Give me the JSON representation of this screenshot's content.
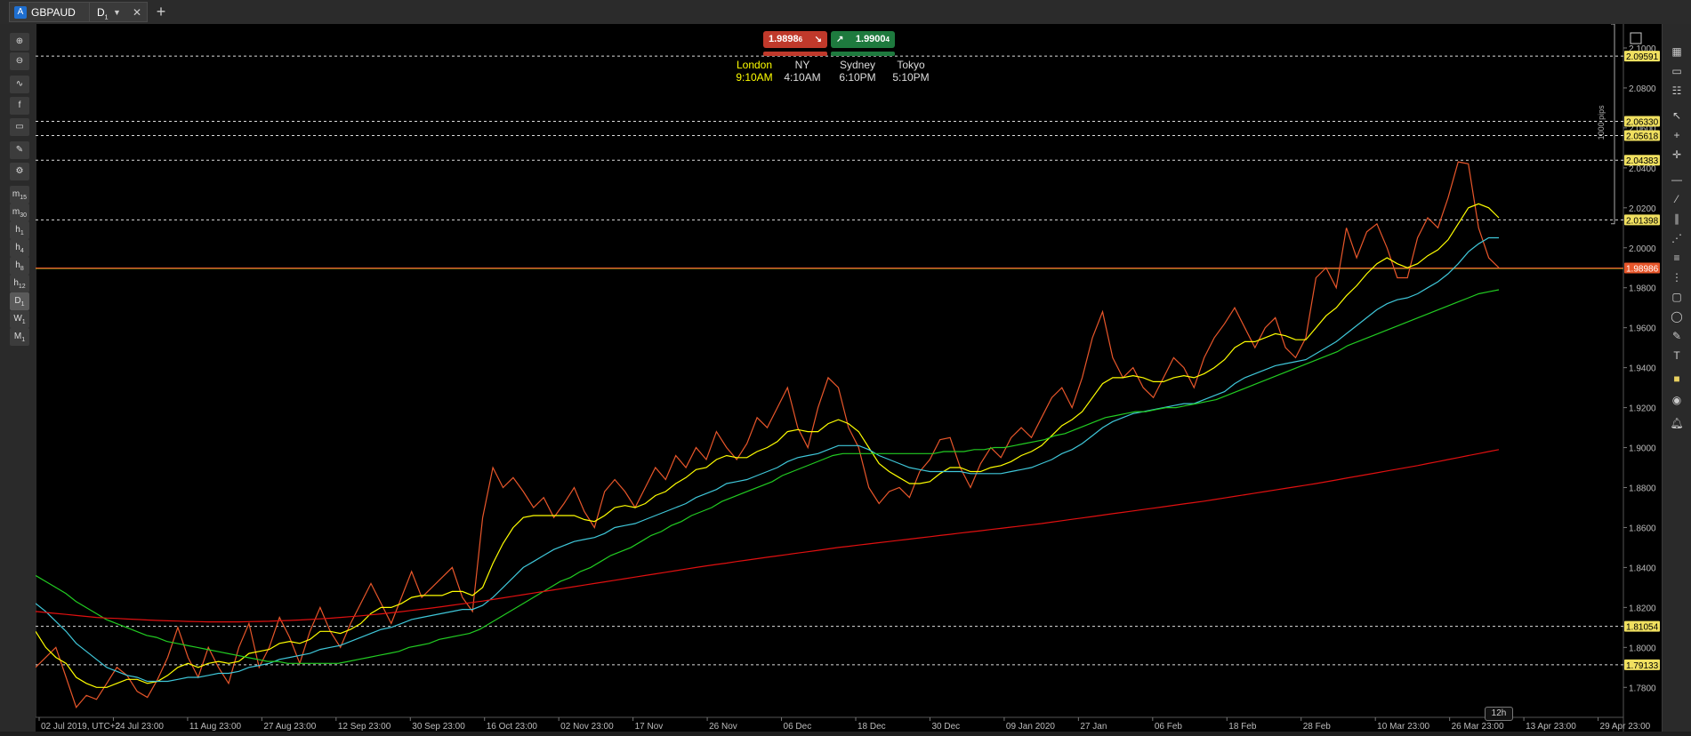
{
  "tabs": {
    "symbol": "GBPAUD",
    "symbol_icon_letter": "A",
    "timeframe": "D",
    "timeframe_sub": "1"
  },
  "left_toolbar": [
    {
      "label": "",
      "icon": "zoom-in-icon"
    },
    {
      "label": "",
      "icon": "zoom-out-icon"
    },
    {
      "label": "",
      "icon": "indicator-icon"
    },
    {
      "label": "",
      "icon": "facebook-icon"
    },
    {
      "label": "",
      "icon": "chart-type-icon"
    },
    {
      "label": "",
      "icon": "paint-icon"
    },
    {
      "label": "",
      "icon": "settings-icon"
    },
    {
      "label": "m",
      "sub": "15"
    },
    {
      "label": "m",
      "sub": "30"
    },
    {
      "label": "h",
      "sub": "1"
    },
    {
      "label": "h",
      "sub": "4"
    },
    {
      "label": "h",
      "sub": "8"
    },
    {
      "label": "h",
      "sub": "12"
    },
    {
      "label": "D",
      "sub": "1"
    },
    {
      "label": "W",
      "sub": "1"
    },
    {
      "label": "M",
      "sub": "1"
    }
  ],
  "prices": {
    "sell": "1.9898",
    "sell_suffix": "6",
    "buy": "1.9900",
    "buy_suffix": "4"
  },
  "sessions": [
    {
      "city": "London",
      "time": "9:10AM",
      "color": "#ffff00"
    },
    {
      "city": "NY",
      "time": "4:10AM",
      "color": "#ffffff"
    },
    {
      "city": "Sydney",
      "time": "6:10PM",
      "color": "#ffffff"
    },
    {
      "city": "Tokyo",
      "time": "5:10PM",
      "color": "#ffffff"
    }
  ],
  "pips_label": "1000 pips",
  "badge": "12h",
  "chart_data": {
    "type": "line",
    "ylim": [
      1.765,
      2.112
    ],
    "y_ticks": [
      "2.1000",
      "2.0800",
      "2.0600",
      "2.0400",
      "2.0200",
      "2.0000",
      "1.9800",
      "1.9600",
      "1.9400",
      "1.9200",
      "1.9000",
      "1.8800",
      "1.8600",
      "1.8400",
      "1.8200",
      "1.8000",
      "1.7800"
    ],
    "x_ticks": [
      "02 Jul 2019, UTC+2",
      "24 Jul 23:00",
      "11 Aug 23:00",
      "27 Aug 23:00",
      "12 Sep 23:00",
      "30 Sep 23:00",
      "16 Oct 23:00",
      "02 Nov 23:00",
      "17 Nov",
      "26 Nov",
      "06 Dec",
      "18 Dec",
      "30 Dec",
      "09 Jan 2020",
      "27 Jan",
      "06 Feb",
      "18 Feb",
      "28 Feb",
      "10 Mar 23:00",
      "26 Mar 23:00",
      "13 Apr 23:00",
      "29 Apr 23:00"
    ],
    "level_lines": [
      {
        "value": 2.09591,
        "label": "2.09591"
      },
      {
        "value": 2.0633,
        "label": "2.06330"
      },
      {
        "value": 2.05618,
        "label": "2.05618"
      },
      {
        "value": 2.04383,
        "label": "2.04383"
      },
      {
        "value": 2.01398,
        "label": "2.01398"
      },
      {
        "value": 1.81054,
        "label": "1.81054"
      },
      {
        "value": 1.79133,
        "label": "1.79133"
      }
    ],
    "current_price": {
      "value": 1.98986,
      "label": "1.98986"
    },
    "series": [
      {
        "color": "#e8562a",
        "values": [
          1.79,
          1.795,
          1.8,
          1.785,
          1.77,
          1.776,
          1.774,
          1.782,
          1.79,
          1.786,
          1.778,
          1.775,
          1.784,
          1.795,
          1.81,
          1.795,
          1.785,
          1.8,
          1.79,
          1.782,
          1.8,
          1.812,
          1.79,
          1.8,
          1.815,
          1.805,
          1.792,
          1.808,
          1.82,
          1.808,
          1.8,
          1.812,
          1.822,
          1.832,
          1.822,
          1.812,
          1.825,
          1.838,
          1.825,
          1.83,
          1.835,
          1.84,
          1.825,
          1.818,
          1.865,
          1.89,
          1.88,
          1.885,
          1.878,
          1.87,
          1.875,
          1.865,
          1.872,
          1.88,
          1.868,
          1.86,
          1.878,
          1.884,
          1.878,
          1.87,
          1.88,
          1.89,
          1.884,
          1.896,
          1.89,
          1.9,
          1.894,
          1.908,
          1.9,
          1.894,
          1.902,
          1.915,
          1.91,
          1.92,
          1.93,
          1.91,
          1.9,
          1.92,
          1.935,
          1.93,
          1.91,
          1.9,
          1.88,
          1.872,
          1.878,
          1.88,
          1.875,
          1.888,
          1.894,
          1.904,
          1.905,
          1.89,
          1.88,
          1.892,
          1.9,
          1.895,
          1.905,
          1.91,
          1.905,
          1.915,
          1.925,
          1.93,
          1.92,
          1.935,
          1.955,
          1.968,
          1.945,
          1.935,
          1.94,
          1.93,
          1.925,
          1.935,
          1.945,
          1.94,
          1.93,
          1.945,
          1.955,
          1.962,
          1.97,
          1.96,
          1.95,
          1.96,
          1.965,
          1.95,
          1.945,
          1.955,
          1.985,
          1.99,
          1.98,
          2.01,
          1.995,
          2.008,
          2.012,
          2.0,
          1.985,
          1.985,
          2.005,
          2.015,
          2.01,
          2.025,
          2.043,
          2.042,
          2.01,
          1.995,
          1.99
        ]
      },
      {
        "color": "#ffff00",
        "values": [
          1.808,
          1.8,
          1.795,
          1.792,
          1.785,
          1.782,
          1.78,
          1.78,
          1.782,
          1.784,
          1.784,
          1.782,
          1.783,
          1.786,
          1.79,
          1.792,
          1.79,
          1.792,
          1.793,
          1.792,
          1.793,
          1.797,
          1.798,
          1.799,
          1.802,
          1.803,
          1.802,
          1.804,
          1.808,
          1.808,
          1.807,
          1.809,
          1.812,
          1.817,
          1.82,
          1.82,
          1.822,
          1.825,
          1.826,
          1.826,
          1.826,
          1.828,
          1.828,
          1.826,
          1.83,
          1.842,
          1.852,
          1.86,
          1.865,
          1.866,
          1.866,
          1.866,
          1.866,
          1.866,
          1.864,
          1.863,
          1.866,
          1.87,
          1.871,
          1.87,
          1.872,
          1.876,
          1.878,
          1.882,
          1.885,
          1.889,
          1.89,
          1.894,
          1.896,
          1.895,
          1.895,
          1.898,
          1.9,
          1.903,
          1.908,
          1.909,
          1.908,
          1.908,
          1.912,
          1.914,
          1.912,
          1.908,
          1.9,
          1.892,
          1.888,
          1.885,
          1.882,
          1.882,
          1.883,
          1.887,
          1.89,
          1.89,
          1.888,
          1.888,
          1.89,
          1.891,
          1.893,
          1.896,
          1.898,
          1.901,
          1.906,
          1.911,
          1.914,
          1.918,
          1.925,
          1.932,
          1.935,
          1.935,
          1.936,
          1.935,
          1.933,
          1.933,
          1.935,
          1.936,
          1.935,
          1.937,
          1.94,
          1.944,
          1.95,
          1.953,
          1.953,
          1.955,
          1.957,
          1.956,
          1.954,
          1.954,
          1.96,
          1.966,
          1.97,
          1.976,
          1.981,
          1.987,
          1.992,
          1.995,
          1.992,
          1.99,
          1.992,
          1.996,
          1.999,
          2.004,
          2.012,
          2.02,
          2.022,
          2.02,
          2.015
        ]
      },
      {
        "color": "#3fc7d9",
        "values": [
          1.822,
          1.818,
          1.813,
          1.808,
          1.802,
          1.798,
          1.794,
          1.79,
          1.788,
          1.786,
          1.785,
          1.783,
          1.783,
          1.783,
          1.784,
          1.785,
          1.785,
          1.786,
          1.787,
          1.787,
          1.788,
          1.79,
          1.791,
          1.792,
          1.794,
          1.795,
          1.796,
          1.797,
          1.799,
          1.8,
          1.801,
          1.803,
          1.805,
          1.807,
          1.809,
          1.81,
          1.812,
          1.814,
          1.815,
          1.816,
          1.817,
          1.818,
          1.819,
          1.819,
          1.821,
          1.825,
          1.83,
          1.835,
          1.84,
          1.843,
          1.846,
          1.849,
          1.851,
          1.853,
          1.854,
          1.855,
          1.857,
          1.86,
          1.861,
          1.862,
          1.864,
          1.866,
          1.868,
          1.87,
          1.872,
          1.875,
          1.877,
          1.879,
          1.882,
          1.883,
          1.884,
          1.886,
          1.888,
          1.89,
          1.893,
          1.895,
          1.896,
          1.897,
          1.899,
          1.901,
          1.901,
          1.901,
          1.899,
          1.896,
          1.894,
          1.892,
          1.89,
          1.889,
          1.888,
          1.888,
          1.888,
          1.888,
          1.887,
          1.887,
          1.887,
          1.887,
          1.888,
          1.889,
          1.89,
          1.892,
          1.894,
          1.897,
          1.899,
          1.902,
          1.906,
          1.91,
          1.913,
          1.915,
          1.917,
          1.918,
          1.919,
          1.92,
          1.921,
          1.922,
          1.922,
          1.924,
          1.926,
          1.928,
          1.932,
          1.935,
          1.937,
          1.939,
          1.941,
          1.942,
          1.943,
          1.944,
          1.947,
          1.95,
          1.953,
          1.957,
          1.961,
          1.965,
          1.969,
          1.972,
          1.974,
          1.975,
          1.977,
          1.98,
          1.983,
          1.987,
          1.992,
          1.998,
          2.002,
          2.005,
          2.005
        ]
      },
      {
        "color": "#22cc22",
        "values": [
          1.836,
          1.833,
          1.83,
          1.827,
          1.823,
          1.82,
          1.817,
          1.814,
          1.812,
          1.81,
          1.808,
          1.806,
          1.805,
          1.803,
          1.802,
          1.801,
          1.8,
          1.799,
          1.798,
          1.797,
          1.796,
          1.795,
          1.794,
          1.793,
          1.793,
          1.792,
          1.792,
          1.792,
          1.792,
          1.792,
          1.792,
          1.793,
          1.794,
          1.795,
          1.796,
          1.797,
          1.798,
          1.8,
          1.801,
          1.802,
          1.804,
          1.805,
          1.806,
          1.807,
          1.809,
          1.812,
          1.815,
          1.818,
          1.821,
          1.824,
          1.827,
          1.83,
          1.833,
          1.835,
          1.838,
          1.84,
          1.843,
          1.846,
          1.848,
          1.85,
          1.853,
          1.856,
          1.858,
          1.861,
          1.863,
          1.866,
          1.868,
          1.87,
          1.873,
          1.875,
          1.877,
          1.879,
          1.881,
          1.883,
          1.886,
          1.888,
          1.89,
          1.892,
          1.894,
          1.896,
          1.897,
          1.897,
          1.897,
          1.897,
          1.897,
          1.897,
          1.897,
          1.897,
          1.897,
          1.897,
          1.898,
          1.898,
          1.898,
          1.899,
          1.899,
          1.9,
          1.9,
          1.901,
          1.902,
          1.903,
          1.904,
          1.906,
          1.907,
          1.909,
          1.911,
          1.913,
          1.915,
          1.916,
          1.917,
          1.918,
          1.918,
          1.919,
          1.92,
          1.92,
          1.921,
          1.922,
          1.923,
          1.924,
          1.926,
          1.928,
          1.93,
          1.932,
          1.934,
          1.936,
          1.938,
          1.94,
          1.942,
          1.944,
          1.946,
          1.948,
          1.951,
          1.953,
          1.955,
          1.957,
          1.959,
          1.961,
          1.963,
          1.965,
          1.967,
          1.969,
          1.971,
          1.973,
          1.975,
          1.977,
          1.978,
          1.979
        ]
      },
      {
        "color": "#e01010",
        "values": [
          1.818,
          1.8175,
          1.817,
          1.8165,
          1.816,
          1.8155,
          1.815,
          1.8147,
          1.8145,
          1.8142,
          1.814,
          1.8137,
          1.8135,
          1.8133,
          1.8132,
          1.813,
          1.8129,
          1.8128,
          1.8128,
          1.8128,
          1.8128,
          1.8129,
          1.813,
          1.8131,
          1.8133,
          1.8135,
          1.8137,
          1.814,
          1.8143,
          1.8146,
          1.815,
          1.8154,
          1.8158,
          1.8163,
          1.8168,
          1.8173,
          1.8179,
          1.8185,
          1.8191,
          1.8197,
          1.8204,
          1.8211,
          1.8218,
          1.8225,
          1.8232,
          1.824,
          1.8248,
          1.8256,
          1.8264,
          1.8272,
          1.828,
          1.8288,
          1.8296,
          1.8304,
          1.8312,
          1.832,
          1.8328,
          1.8336,
          1.8344,
          1.8352,
          1.836,
          1.8368,
          1.8376,
          1.8384,
          1.8392,
          1.84,
          1.8408,
          1.8415,
          1.8422,
          1.843,
          1.8437,
          1.8444,
          1.8451,
          1.8458,
          1.8465,
          1.8472,
          1.8479,
          1.8486,
          1.8493,
          1.85,
          1.8506,
          1.8512,
          1.8518,
          1.8524,
          1.853,
          1.8536,
          1.8542,
          1.8548,
          1.8554,
          1.856,
          1.8566,
          1.8572,
          1.8578,
          1.8584,
          1.859,
          1.8596,
          1.8602,
          1.8608,
          1.8614,
          1.862,
          1.8627,
          1.8634,
          1.8641,
          1.8648,
          1.8655,
          1.8662,
          1.8669,
          1.8676,
          1.8683,
          1.869,
          1.8697,
          1.8704,
          1.8711,
          1.8718,
          1.8725,
          1.8732,
          1.874,
          1.8748,
          1.8756,
          1.8764,
          1.8772,
          1.878,
          1.8788,
          1.8796,
          1.8804,
          1.8812,
          1.882,
          1.8829,
          1.8838,
          1.8847,
          1.8856,
          1.8865,
          1.8874,
          1.8883,
          1.8892,
          1.8901,
          1.891,
          1.892,
          1.893,
          1.894,
          1.895,
          1.896,
          1.897,
          1.898,
          1.899
        ]
      }
    ]
  }
}
